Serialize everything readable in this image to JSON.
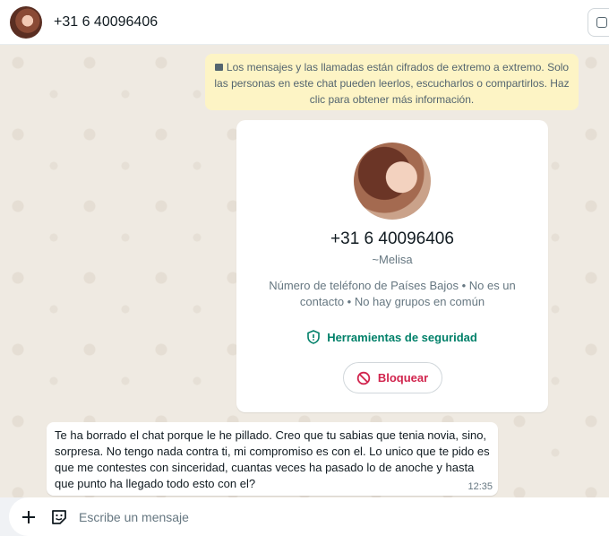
{
  "header": {
    "contact_title": "+31 6 40096406"
  },
  "encryption_notice": {
    "text": "Los mensajes y las llamadas están cifrados de extremo a extremo. Solo las personas en este chat pueden leerlos, escucharlos o compartirlos. Haz clic para obtener más información."
  },
  "contact_card": {
    "phone": "+31 6 40096406",
    "nickname": "~Melisa",
    "description": "Número de teléfono de Países Bajos • No es un contacto • No hay grupos en común",
    "security_tools_label": "Herramientas de seguridad",
    "block_label": "Bloquear"
  },
  "messages": [
    {
      "text": "Te ha borrado el chat porque le he pillado. Creo que tu sabias que tenia novia, sino, sorpresa. No tengo nada contra ti, mi compromiso es con el. Lo unico que te pido es que me contestes con sinceridad, cuantas veces ha pasado lo de anoche y hasta que punto ha llegado todo esto con el?",
      "time": "12:35"
    }
  ],
  "composer": {
    "placeholder": "Escribe un mensaje"
  },
  "colors": {
    "accent_green": "#008069",
    "block_red": "#d1244d",
    "notice_yellow": "#fdf4c5",
    "chat_background": "#efeae2"
  },
  "icons": [
    "lock-icon",
    "shield-icon",
    "block-icon",
    "plus-icon",
    "sticker-icon",
    "window-icon"
  ]
}
